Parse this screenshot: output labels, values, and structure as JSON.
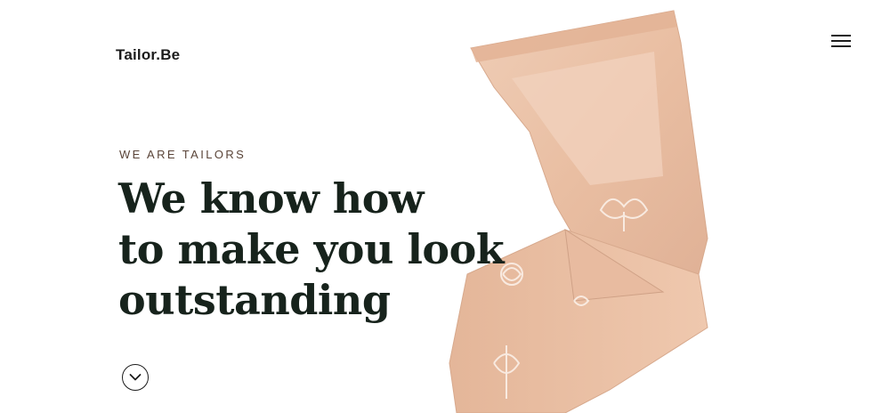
{
  "header": {
    "logo_text": "Tailor.Be",
    "menu_icon": "hamburger-menu-icon"
  },
  "hero": {
    "eyebrow": "WE ARE TAILORS",
    "headline_lines": [
      "We know how",
      "to make you look",
      "outstanding"
    ],
    "scroll_icon": "chevron-down-icon"
  },
  "colors": {
    "text_dark": "#17231c",
    "eyebrow": "#5a4438",
    "fabric": "#ebc1a6",
    "background": "#ffffff"
  }
}
